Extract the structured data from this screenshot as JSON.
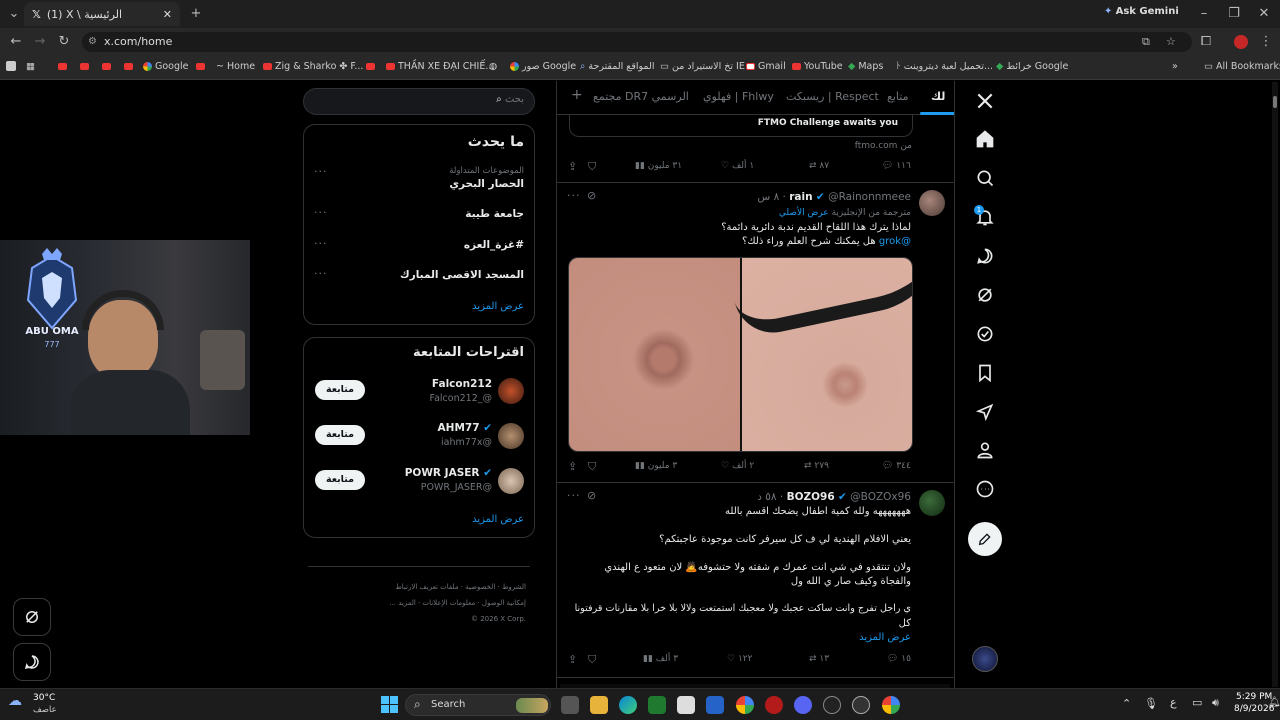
{
  "browser": {
    "tab_title": "(1) X \\ الرئيسية",
    "new_tab": "+",
    "ask_gemini": "Ask Gemini",
    "url": "x.com/home",
    "bookmarks": [
      "Google",
      "Home",
      "Zig & Sharko ✤ F...",
      "THẦN XE ĐẠI CHIẾ...",
      "صور Google",
      "المواقع المقترحة",
      "تخ الاستيراد من IE",
      "Gmail",
      "YouTube",
      "Maps",
      "تحميل لعبة ديتروينت...",
      "خرائط Google"
    ],
    "all_bookmarks": "All Bookmarks"
  },
  "nav": {
    "logo": "X",
    "items": [
      "home-icon",
      "search-icon",
      "notifications-icon",
      "messages-icon",
      "grok-icon",
      "verified-icon",
      "bookmarks-icon",
      "rocket-icon",
      "profile-icon",
      "more-icon"
    ],
    "notif_badge": "1",
    "compose": "compose-icon"
  },
  "feed": {
    "tabs": [
      "لك",
      "متابع",
      "ريسبكت | Respect",
      "فهلوي | Fhlwy",
      "مجتمع DR7 الرسمي"
    ],
    "add_tab": "+",
    "ad": {
      "card_text": "FTMO Challenge awaits you",
      "source": "من ftmo.com",
      "replies": "١١٦",
      "reposts": "٨٧",
      "likes": "١ ألف",
      "views": "٣١ مليون"
    },
    "post1": {
      "name": "rain",
      "handle": "@Rainonnmeee",
      "time": "٨ س",
      "translated": "مترجمة من الإنجليزية",
      "show_original": "عرض الأصلي",
      "line1": "لماذا يترك هذا اللقاح القديم ندبة دائرية دائمة؟",
      "line2_mention": "@grok",
      "line2": "هل يمكنك شرح العلم وراء ذلك؟",
      "replies": "٣٤٤",
      "reposts": "٢٧٩",
      "likes": "٢ ألف",
      "views": "٣ مليون"
    },
    "post2": {
      "name": "BOZO96",
      "handle": "@BOZOx96",
      "time": "٥٨ د",
      "l1": "هههههههه ولله كمية اطفال يضحك اقسم بالله",
      "l2": "يعني الافلام الهندية لي ف كل سيرفر  كانت  موجودة عاجبتكم؟",
      "l3": "ولان تنتقدو في  شي انت عمرك م شفته ولا حتشوفه🙇 لان متعود ع الهندي",
      "l4": "والفجاة وكيف صار ي الله ول",
      "l5": "ي راجل تفرج وانت ساكت عجبك ولا معجبك استمتعت ولالا بلا خرا بلا مقارنات قرفتونا",
      "l6": "كل",
      "show_more": "عرض المزيد",
      "replies": "١٥",
      "reposts": "١٣",
      "likes": "١٢٢",
      "views": "٣ ألف"
    }
  },
  "sidebar": {
    "search_placeholder": "بحث",
    "trends_title": "ما يحدث",
    "trends": [
      {
        "context": "الموضوعات المتداولة",
        "name": "الحصار البحري"
      },
      {
        "context": "",
        "name": "جامعة طيبة"
      },
      {
        "context": "",
        "name": "#غزة_العزه"
      },
      {
        "context": "",
        "name": "المسجد الاقصى المبارك"
      }
    ],
    "trends_more": "عرض المزيد",
    "follow_title": "اقتراحات المتابعة",
    "follow": [
      {
        "name": "Falcon212",
        "handle": "@_Falcon212",
        "button": "متابعة"
      },
      {
        "name": "AHM77",
        "handle": "@iahm77x",
        "button": "متابعة"
      },
      {
        "name": "POWR JASER",
        "handle": "@POWR_JASER",
        "button": "متابعة"
      }
    ],
    "follow_more": "عرض المزيد",
    "footer": [
      "الشروط",
      "الخصوصية",
      "ملفات تعريف الارتباط",
      "إمكانية الوصول",
      "معلومات الإعلانات",
      "المزيد ...",
      "© 2026 X Corp."
    ]
  },
  "webcam": {
    "logo_text": "ABU OMA",
    "logo_sub": "777"
  },
  "taskbar": {
    "temp": "30°C",
    "weather": "عاصف",
    "search": "Search",
    "lang": "ع",
    "time": "5:29 PM",
    "date": "8/9/2026"
  },
  "colors": {
    "accent": "#1d9bf0",
    "bg": "#000000",
    "border": "#2f3336"
  }
}
